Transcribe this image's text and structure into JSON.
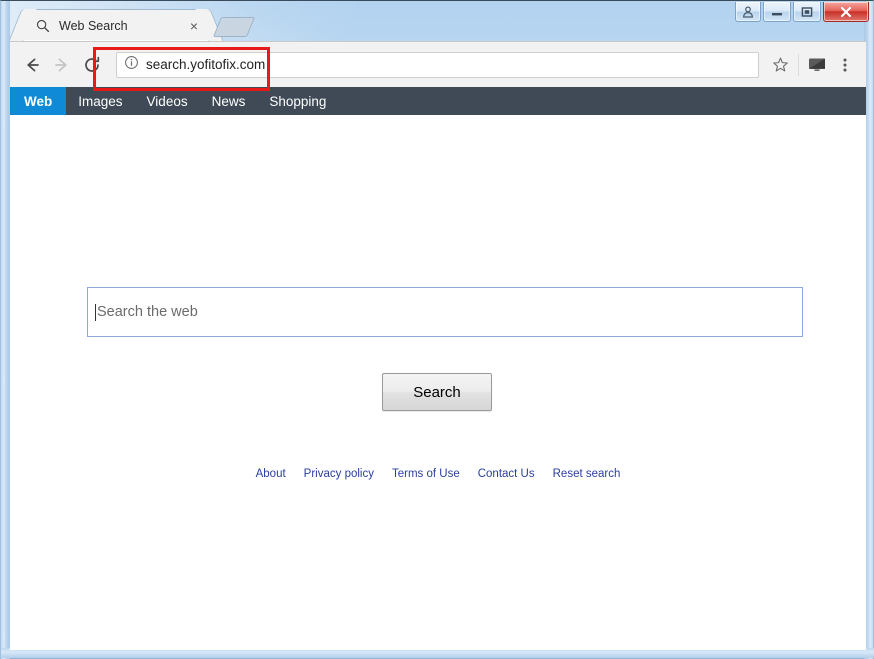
{
  "window": {
    "controls": [
      {
        "name": "user-account-button",
        "icon": "user-icon",
        "label": ""
      },
      {
        "name": "minimize-button",
        "icon": "minimize-icon",
        "label": ""
      },
      {
        "name": "maximize-button",
        "icon": "maximize-icon",
        "label": ""
      },
      {
        "name": "close-button",
        "icon": "close-icon",
        "label": ""
      }
    ]
  },
  "tab": {
    "favicon": "magnifier-icon",
    "title": "Web Search",
    "close_glyph": "×"
  },
  "toolbar": {
    "back_icon": "back-arrow-icon",
    "forward_icon": "forward-arrow-icon",
    "reload_icon": "reload-icon",
    "site_info_icon": "info-circle-icon",
    "url": "search.yofitofix.com",
    "bookmark_icon": "star-icon",
    "cast_icon": "cast-icon",
    "menu_icon": "three-dots-icon"
  },
  "annotation": {
    "shape": "rectangle",
    "color": "#e8191a",
    "target": "address-bar-url"
  },
  "site": {
    "nav": [
      {
        "label": "Web",
        "active": true
      },
      {
        "label": "Images",
        "active": false
      },
      {
        "label": "Videos",
        "active": false
      },
      {
        "label": "News",
        "active": false
      },
      {
        "label": "Shopping",
        "active": false
      }
    ],
    "nav_bg": "#3f4a56",
    "nav_active_bg": "#0e8ad6",
    "search": {
      "value": "",
      "placeholder": "Search the web",
      "button_label": "Search"
    },
    "footer": [
      {
        "label": "About"
      },
      {
        "label": "Privacy policy"
      },
      {
        "label": "Terms of Use"
      },
      {
        "label": "Contact Us"
      },
      {
        "label": "Reset search"
      }
    ],
    "footer_link_color": "#2b3f9e"
  }
}
